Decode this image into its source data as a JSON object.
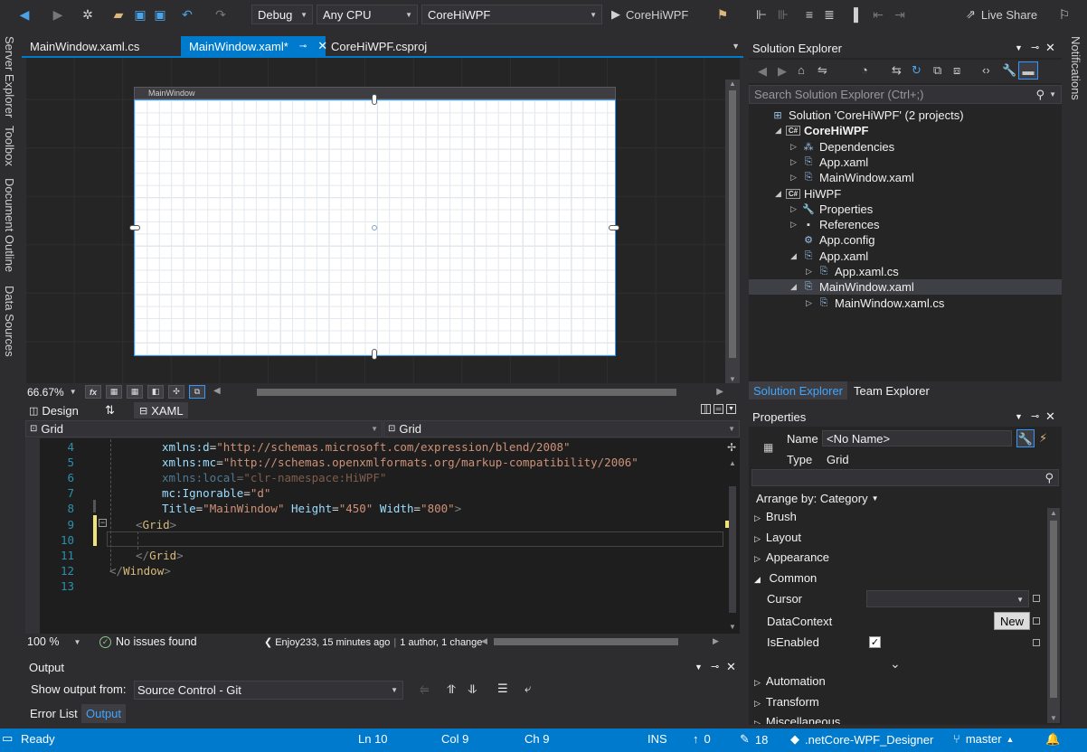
{
  "toolbar": {
    "config": "Debug",
    "platform": "Any CPU",
    "startup_project": "CoreHiWPF",
    "run_label": "CoreHiWPF",
    "live_share": "Live Share"
  },
  "left_rail": [
    "Server Explorer",
    "Toolbox",
    "Document Outline",
    "Data Sources"
  ],
  "right_rail": [
    "Notifications"
  ],
  "doc_tabs": [
    {
      "label": "MainWindow.xaml.cs",
      "active": false
    },
    {
      "label": "MainWindow.xaml*",
      "active": true
    },
    {
      "label": "CoreHiWPF.csproj",
      "active": false
    }
  ],
  "designer": {
    "window_title": "MainWindow",
    "zoom": "66.67%",
    "fx_label": "fx"
  },
  "split_tabs": {
    "design": "Design",
    "swap": "⇅",
    "xaml": "XAML"
  },
  "nav": {
    "left": "Grid",
    "right": "Grid"
  },
  "editor": {
    "line_numbers": [
      "4",
      "5",
      "6",
      "7",
      "8",
      "9",
      "10",
      "11",
      "12",
      "13"
    ],
    "lines": [
      {
        "parts": [
          {
            "c": "c-attr",
            "t": "xmlns:d"
          },
          {
            "c": "c-txt",
            "t": "="
          },
          {
            "c": "c-str",
            "t": "\"http://schemas.microsoft.com/expression/blend/2008\""
          }
        ]
      },
      {
        "parts": [
          {
            "c": "c-attr",
            "t": "xmlns:mc"
          },
          {
            "c": "c-txt",
            "t": "="
          },
          {
            "c": "c-str",
            "t": "\"http://schemas.openxmlformats.org/markup-compatibility/2006\""
          }
        ]
      },
      {
        "parts": [
          {
            "c": "c-attr",
            "t": "xmlns:local"
          },
          {
            "c": "c-txt",
            "t": "="
          },
          {
            "c": "c-str",
            "t": "\"clr-namespace:HiWPF\""
          }
        ],
        "faded": true
      },
      {
        "parts": [
          {
            "c": "c-attr",
            "t": "mc:Ignorable"
          },
          {
            "c": "c-txt",
            "t": "="
          },
          {
            "c": "c-str",
            "t": "\"d\""
          }
        ]
      },
      {
        "parts": [
          {
            "c": "c-attr",
            "t": "Title"
          },
          {
            "c": "c-txt",
            "t": "="
          },
          {
            "c": "c-str",
            "t": "\"MainWindow\""
          },
          {
            "c": "c-txt",
            "t": " "
          },
          {
            "c": "c-attr",
            "t": "Height"
          },
          {
            "c": "c-txt",
            "t": "="
          },
          {
            "c": "c-str",
            "t": "\"450\""
          },
          {
            "c": "c-txt",
            "t": " "
          },
          {
            "c": "c-attr",
            "t": "Width"
          },
          {
            "c": "c-txt",
            "t": "="
          },
          {
            "c": "c-str",
            "t": "\"800\""
          },
          {
            "c": "c-br",
            "t": ">"
          }
        ]
      },
      {
        "parts": [
          {
            "c": "c-br",
            "t": "<"
          },
          {
            "c": "c-tag",
            "t": "Grid"
          },
          {
            "c": "c-br",
            "t": ">"
          }
        ]
      },
      {
        "parts": []
      },
      {
        "parts": [
          {
            "c": "c-br",
            "t": "</"
          },
          {
            "c": "c-tag",
            "t": "Grid"
          },
          {
            "c": "c-br",
            "t": ">"
          }
        ]
      },
      {
        "parts": [
          {
            "c": "c-br",
            "t": "</"
          },
          {
            "c": "c-tag",
            "t": "Window"
          },
          {
            "c": "c-br",
            "t": ">"
          }
        ]
      },
      {
        "parts": []
      }
    ]
  },
  "editor_status": {
    "zoom": "100 %",
    "issues": "No issues found",
    "blame": "Enjoy233, 15 minutes ago",
    "blame_detail": "1 author, 1 change"
  },
  "output": {
    "title": "Output",
    "show_from_label": "Show output from:",
    "source": "Source Control - Git"
  },
  "bottom_tabs": [
    {
      "label": "Error List",
      "active": false
    },
    {
      "label": "Output",
      "active": true
    }
  ],
  "statusbar": {
    "ready": "Ready",
    "ln": "Ln 10",
    "col": "Col 9",
    "ch": "Ch 9",
    "ins": "INS",
    "up": "0",
    "edits": "18",
    "repo": ".netCore-WPF_Designer",
    "branch": "master"
  },
  "solution_explorer": {
    "title": "Solution Explorer",
    "search_placeholder": "Search Solution Explorer (Ctrl+;)",
    "tree": [
      {
        "label": "Solution 'CoreHiWPF' (2 projects)",
        "indent": 0,
        "twisty": "",
        "icon": "solution-icon",
        "bold": false
      },
      {
        "label": "CoreHiWPF",
        "indent": 1,
        "twisty": "◢",
        "icon": "csharp-project-icon",
        "bold": true
      },
      {
        "label": "Dependencies",
        "indent": 2,
        "twisty": "▷",
        "icon": "dependencies-icon",
        "bold": false
      },
      {
        "label": "App.xaml",
        "indent": 2,
        "twisty": "▷",
        "icon": "xaml-file-icon",
        "bold": false
      },
      {
        "label": "MainWindow.xaml",
        "indent": 2,
        "twisty": "▷",
        "icon": "xaml-file-icon",
        "bold": false
      },
      {
        "label": "HiWPF",
        "indent": 1,
        "twisty": "◢",
        "icon": "csharp-project-icon",
        "bold": false
      },
      {
        "label": "Properties",
        "indent": 2,
        "twisty": "▷",
        "icon": "wrench-icon",
        "bold": false
      },
      {
        "label": "References",
        "indent": 2,
        "twisty": "▷",
        "icon": "references-icon",
        "bold": false
      },
      {
        "label": "App.config",
        "indent": 2,
        "twisty": "",
        "icon": "config-file-icon",
        "bold": false
      },
      {
        "label": "App.xaml",
        "indent": 2,
        "twisty": "◢",
        "icon": "xaml-file-icon",
        "bold": false
      },
      {
        "label": "App.xaml.cs",
        "indent": 3,
        "twisty": "▷",
        "icon": "cs-file-icon",
        "bold": false
      },
      {
        "label": "MainWindow.xaml",
        "indent": 2,
        "twisty": "◢",
        "icon": "xaml-file-icon",
        "bold": false,
        "selected": true
      },
      {
        "label": "MainWindow.xaml.cs",
        "indent": 3,
        "twisty": "▷",
        "icon": "cs-file-icon",
        "bold": false
      }
    ],
    "tabs": [
      {
        "label": "Solution Explorer",
        "active": true
      },
      {
        "label": "Team Explorer",
        "active": false
      }
    ]
  },
  "properties": {
    "title": "Properties",
    "name_label": "Name",
    "name_value": "<No Name>",
    "type_label": "Type",
    "type_value": "Grid",
    "arrange_by": "Arrange by: Category",
    "categories": [
      "Brush",
      "Layout",
      "Appearance"
    ],
    "common_label": "Common",
    "common_props": [
      {
        "label": "Cursor"
      },
      {
        "label": "DataContext",
        "button": "New"
      },
      {
        "label": "IsEnabled",
        "checked": true
      }
    ],
    "more_categories": [
      "Automation",
      "Transform",
      "Miscellaneous"
    ]
  },
  "colors": {
    "accent": "#007acc",
    "background": "#2d2d30",
    "editor": "#1e1e1e"
  }
}
